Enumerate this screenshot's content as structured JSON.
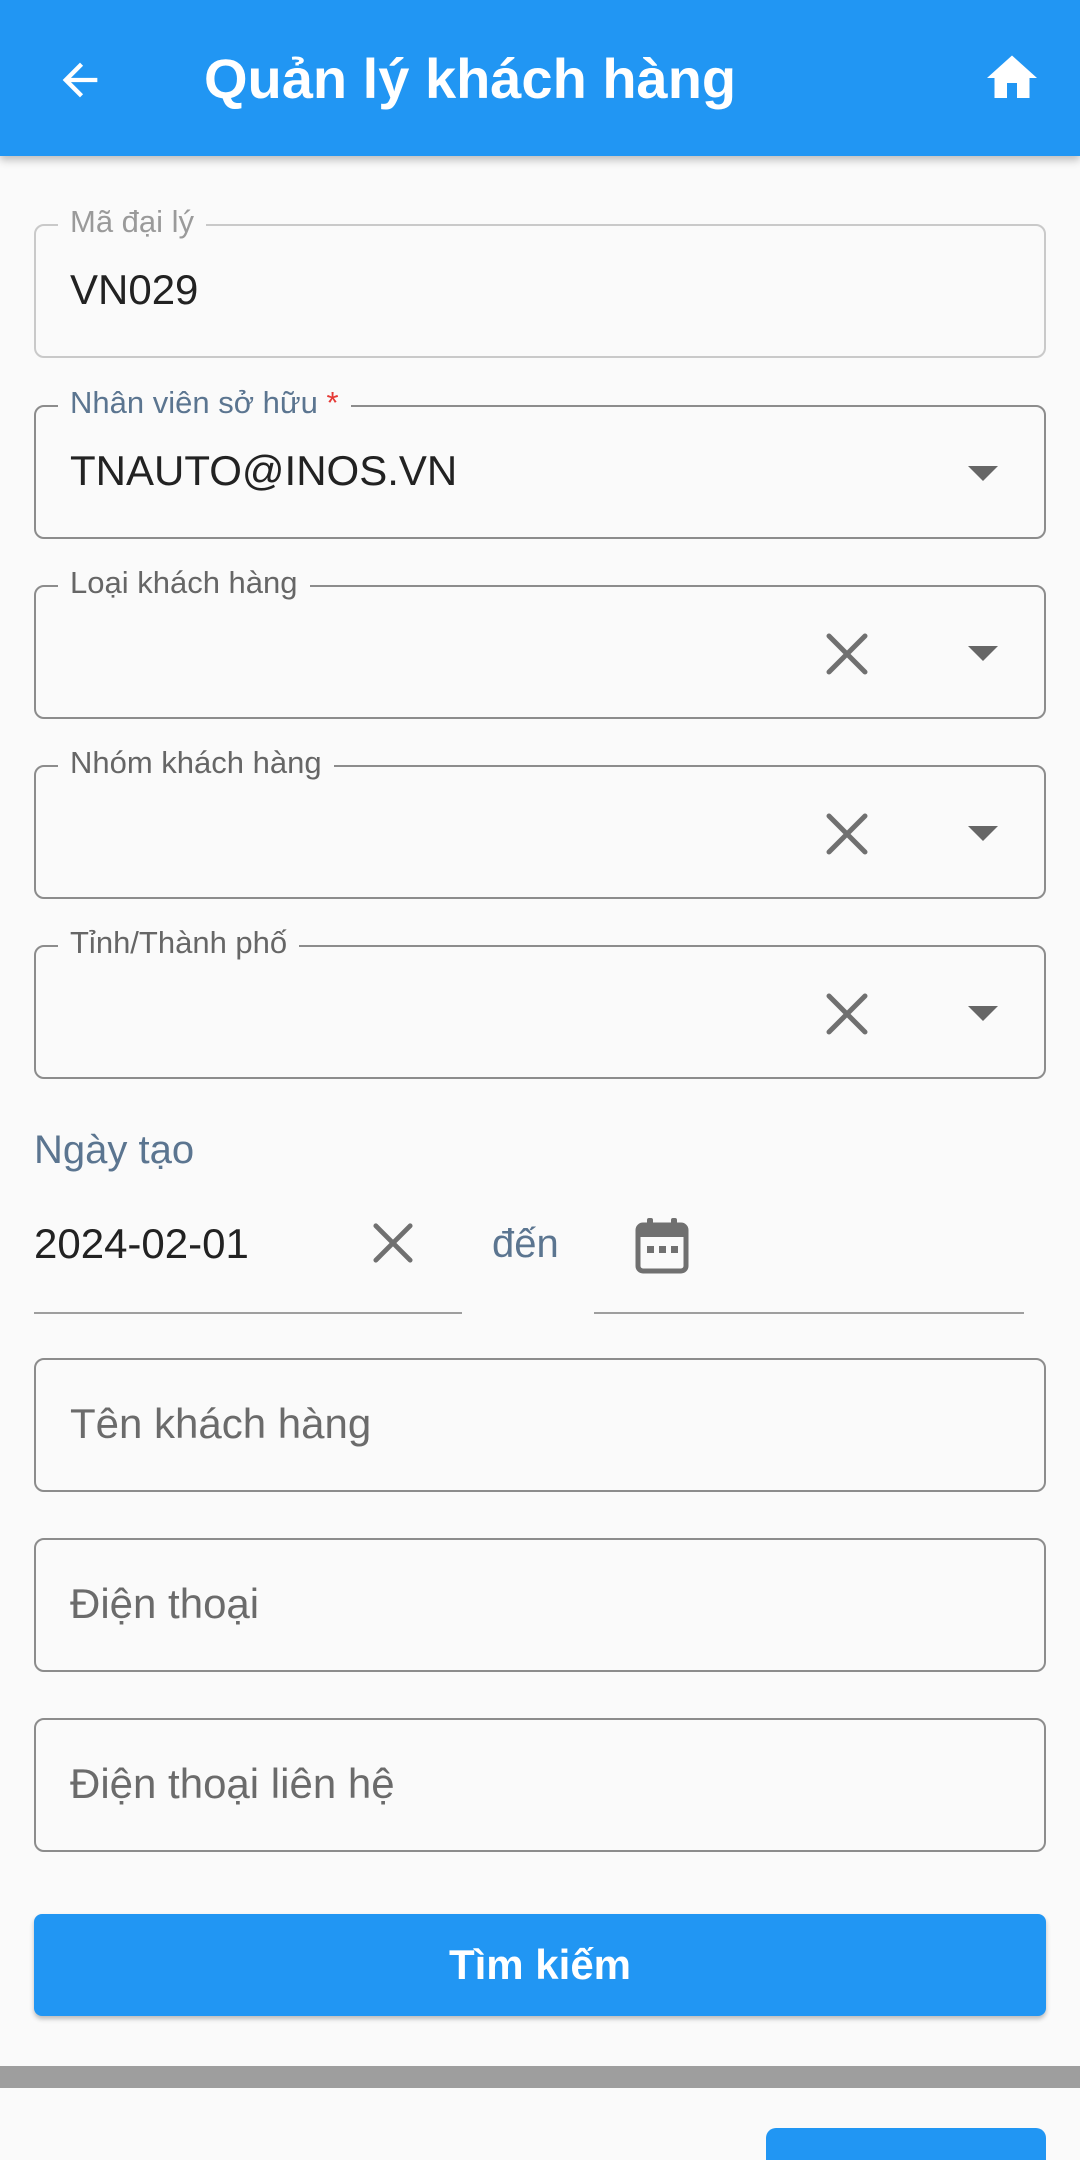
{
  "appbar": {
    "title": "Quản lý khách hàng",
    "back_icon": "arrow-left-icon",
    "home_icon": "home-icon",
    "background": "#2196f3"
  },
  "form": {
    "agent_code": {
      "label": "Mã đại lý",
      "value": "VN029"
    },
    "owner": {
      "label": "Nhân viên sở hữu",
      "required_mark": "*",
      "value": "TNAUTO@INOS.VN"
    },
    "customer_type": {
      "label": "Loại khách hàng",
      "value": ""
    },
    "customer_group": {
      "label": "Nhóm khách hàng",
      "value": ""
    },
    "province": {
      "label": "Tỉnh/Thành phố",
      "value": ""
    },
    "created_date": {
      "label": "Ngày tạo",
      "from": "2024-02-01",
      "separator": "đến",
      "to": ""
    },
    "customer_name": {
      "placeholder": "Tên khách hàng"
    },
    "phone": {
      "placeholder": "Điện thoại"
    },
    "contact_phone": {
      "placeholder": "Điện thoại liên hệ"
    },
    "search_button": "Tìm kiếm"
  }
}
